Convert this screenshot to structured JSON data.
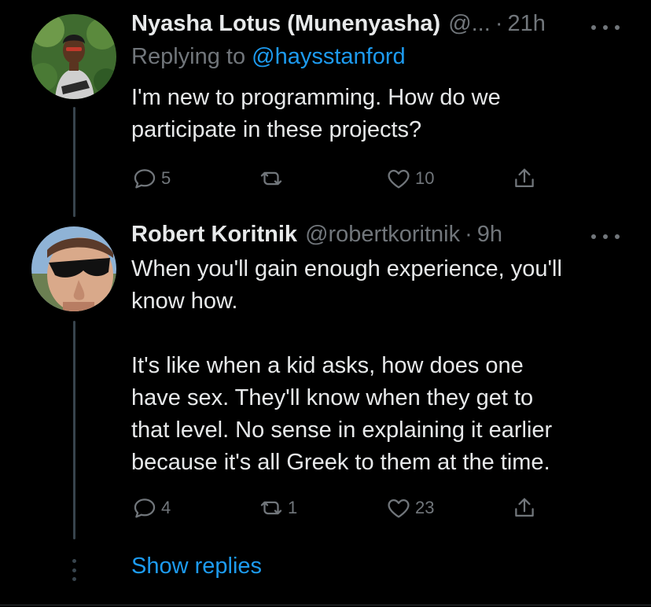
{
  "tweets": [
    {
      "name": "Nyasha Lotus (Munenyasha)",
      "handle": "@...",
      "separator": "·",
      "time": "21h",
      "replying_prefix": "Replying to ",
      "replying_to": "@haysstanford",
      "text": "I'm new to programming. How do we\nparticipate in these projects?",
      "replies": "5",
      "retweets": "",
      "likes": "10"
    },
    {
      "name": "Robert Koritnik",
      "handle": "@robertkoritnik",
      "separator": "·",
      "time": "9h",
      "text": "When you'll gain enough experience, you'll\nknow how.\n\nIt's like when a kid asks, how does one\nhave sex. They'll know when they get to\nthat level. No sense in explaining it earlier\nbecause it's all Greek to them at the time.",
      "replies": "4",
      "retweets": "1",
      "likes": "23"
    }
  ],
  "show_replies_label": "Show replies",
  "icons": [
    "reply-icon",
    "retweet-icon",
    "like-icon",
    "share-icon",
    "more-icon"
  ],
  "colors": {
    "background": "#000000",
    "text": "#e7e9ea",
    "secondary": "#71767b",
    "link": "#1d9bf0"
  }
}
